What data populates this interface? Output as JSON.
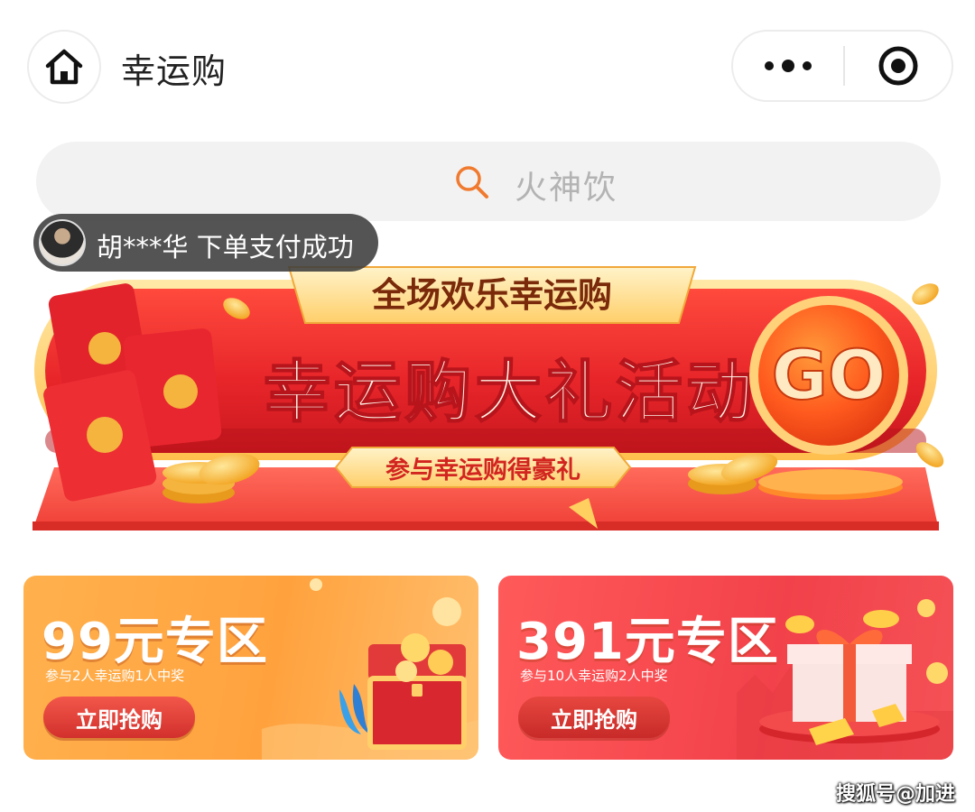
{
  "nav": {
    "title": "幸运购"
  },
  "search": {
    "placeholder": "火神饮"
  },
  "toast": {
    "text": "胡***华 下单支付成功"
  },
  "banner": {
    "ribbon": "全场欢乐幸运购",
    "headline": "幸运购大礼活动",
    "subtitle": "参与幸运购得豪礼",
    "go_label": "GO"
  },
  "zones": [
    {
      "title": "99元专区",
      "desc": "参与2人幸运购1人中奖",
      "button": "立即抢购"
    },
    {
      "title": "391元专区",
      "desc": "参与10人幸运购2人中奖",
      "button": "立即抢购"
    }
  ],
  "watermark": "搜狐号@加进",
  "colors": {
    "accent_red": "#e8262a",
    "gold": "#ffd27a",
    "orange_card": "#ffa23e",
    "red_card": "#f2414a"
  }
}
